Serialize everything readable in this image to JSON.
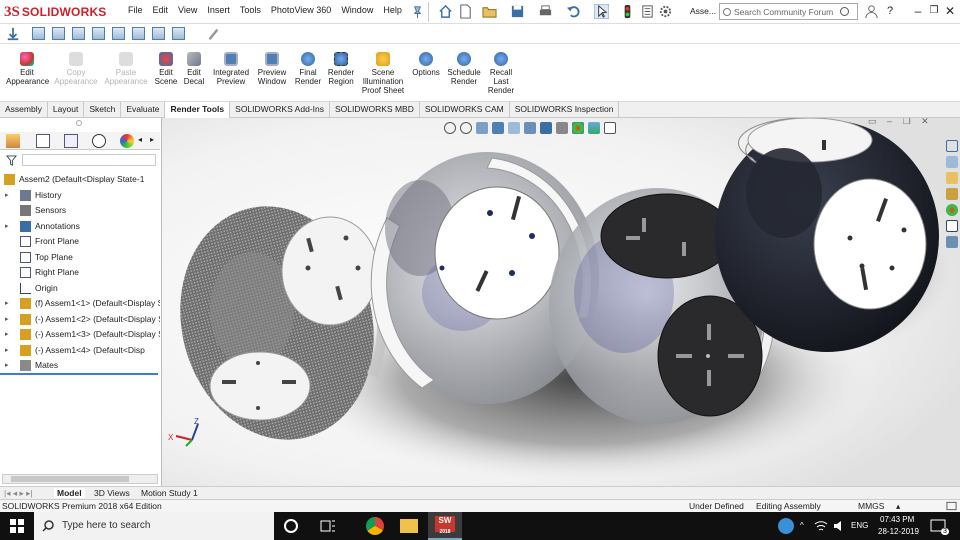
{
  "app": {
    "logo_ds": "3S",
    "logo_name": "SOLIDWORKS",
    "menu": [
      "File",
      "Edit",
      "View",
      "Insert",
      "Tools",
      "PhotoView 360",
      "Window",
      "Help"
    ],
    "doc_short": "Asse...",
    "search_placeholder": "Search Community Forum"
  },
  "ribbon": {
    "buttons": [
      {
        "label": "Edit\nAppearance",
        "enabled": true,
        "color": "#c8372d"
      },
      {
        "label": "Copy\nAppearance",
        "enabled": false,
        "color": "#c9c9c9"
      },
      {
        "label": "Paste\nAppearance",
        "enabled": false,
        "color": "#c9c9c9"
      },
      {
        "label": "Edit\nScene",
        "enabled": true,
        "color": "#3b6ea5"
      },
      {
        "label": "Edit\nDecal",
        "enabled": true,
        "color": "#6b7a8c"
      },
      {
        "label": "Integrated\nPreview",
        "enabled": true,
        "color": "#4f7fb3"
      },
      {
        "label": "Preview\nWindow",
        "enabled": true,
        "color": "#4f7fb3"
      },
      {
        "label": "Final\nRender",
        "enabled": true,
        "color": "#2d66a6"
      },
      {
        "label": "Render\nRegion",
        "enabled": true,
        "color": "#4f7fb3"
      },
      {
        "label": "Scene\nIllumination\nProof Sheet",
        "enabled": true,
        "color": "#d8a020"
      },
      {
        "label": "Options",
        "enabled": true,
        "color": "#2d66a6"
      },
      {
        "label": "Schedule\nRender",
        "enabled": true,
        "color": "#2d66a6"
      },
      {
        "label": "Recall\nLast\nRender",
        "enabled": true,
        "color": "#2d66a6"
      }
    ]
  },
  "tabs": [
    "Assembly",
    "Layout",
    "Sketch",
    "Evaluate",
    "Render Tools",
    "SOLIDWORKS Add-Ins",
    "SOLIDWORKS MBD",
    "SOLIDWORKS CAM",
    "SOLIDWORKS Inspection"
  ],
  "active_tab": "Render Tools",
  "tree": [
    {
      "label": "Assem2  (Default<Display State-1",
      "expand": false,
      "indent": 0,
      "icon": "assembly-icon"
    },
    {
      "label": "History",
      "expand": true,
      "indent": 1,
      "icon": "history-icon"
    },
    {
      "label": "Sensors",
      "expand": false,
      "indent": 1,
      "icon": "sensors-icon"
    },
    {
      "label": "Annotations",
      "expand": true,
      "indent": 1,
      "icon": "annotations-icon"
    },
    {
      "label": "Front Plane",
      "expand": false,
      "indent": 1,
      "icon": "plane-icon"
    },
    {
      "label": "Top Plane",
      "expand": false,
      "indent": 1,
      "icon": "plane-icon"
    },
    {
      "label": "Right Plane",
      "expand": false,
      "indent": 1,
      "icon": "plane-icon"
    },
    {
      "label": "Origin",
      "expand": false,
      "indent": 1,
      "icon": "origin-icon"
    },
    {
      "label": "(f) Assem1<1> (Default<Display S",
      "expand": true,
      "indent": 1,
      "icon": "subassembly-icon"
    },
    {
      "label": "(-) Assem1<2> (Default<Display S",
      "expand": true,
      "indent": 1,
      "icon": "subassembly-icon"
    },
    {
      "label": "(-) Assem1<3> (Default<Display S",
      "expand": true,
      "indent": 1,
      "icon": "subassembly-icon"
    },
    {
      "label": "(-) Assem1<4> (Default<Disp",
      "expand": true,
      "indent": 1,
      "icon": "subassembly-icon"
    },
    {
      "label": "Mates",
      "expand": true,
      "indent": 1,
      "icon": "mates-icon"
    }
  ],
  "model_tabs": [
    "Model",
    "3D Views",
    "Motion Study 1"
  ],
  "active_model_tab": "Model",
  "status": {
    "edition": "SOLIDWORKS Premium 2018 x64 Edition",
    "state": "Under Defined",
    "mode": "Editing Assembly",
    "units": "MMGS"
  },
  "taskbar": {
    "search_placeholder": "Type here to search",
    "lang": "ENG",
    "time": "07:43 PM",
    "date": "28-12-2019",
    "notif_count": "3",
    "sw_badge": "2018"
  },
  "triad": {
    "x": "X",
    "z": "Z"
  }
}
